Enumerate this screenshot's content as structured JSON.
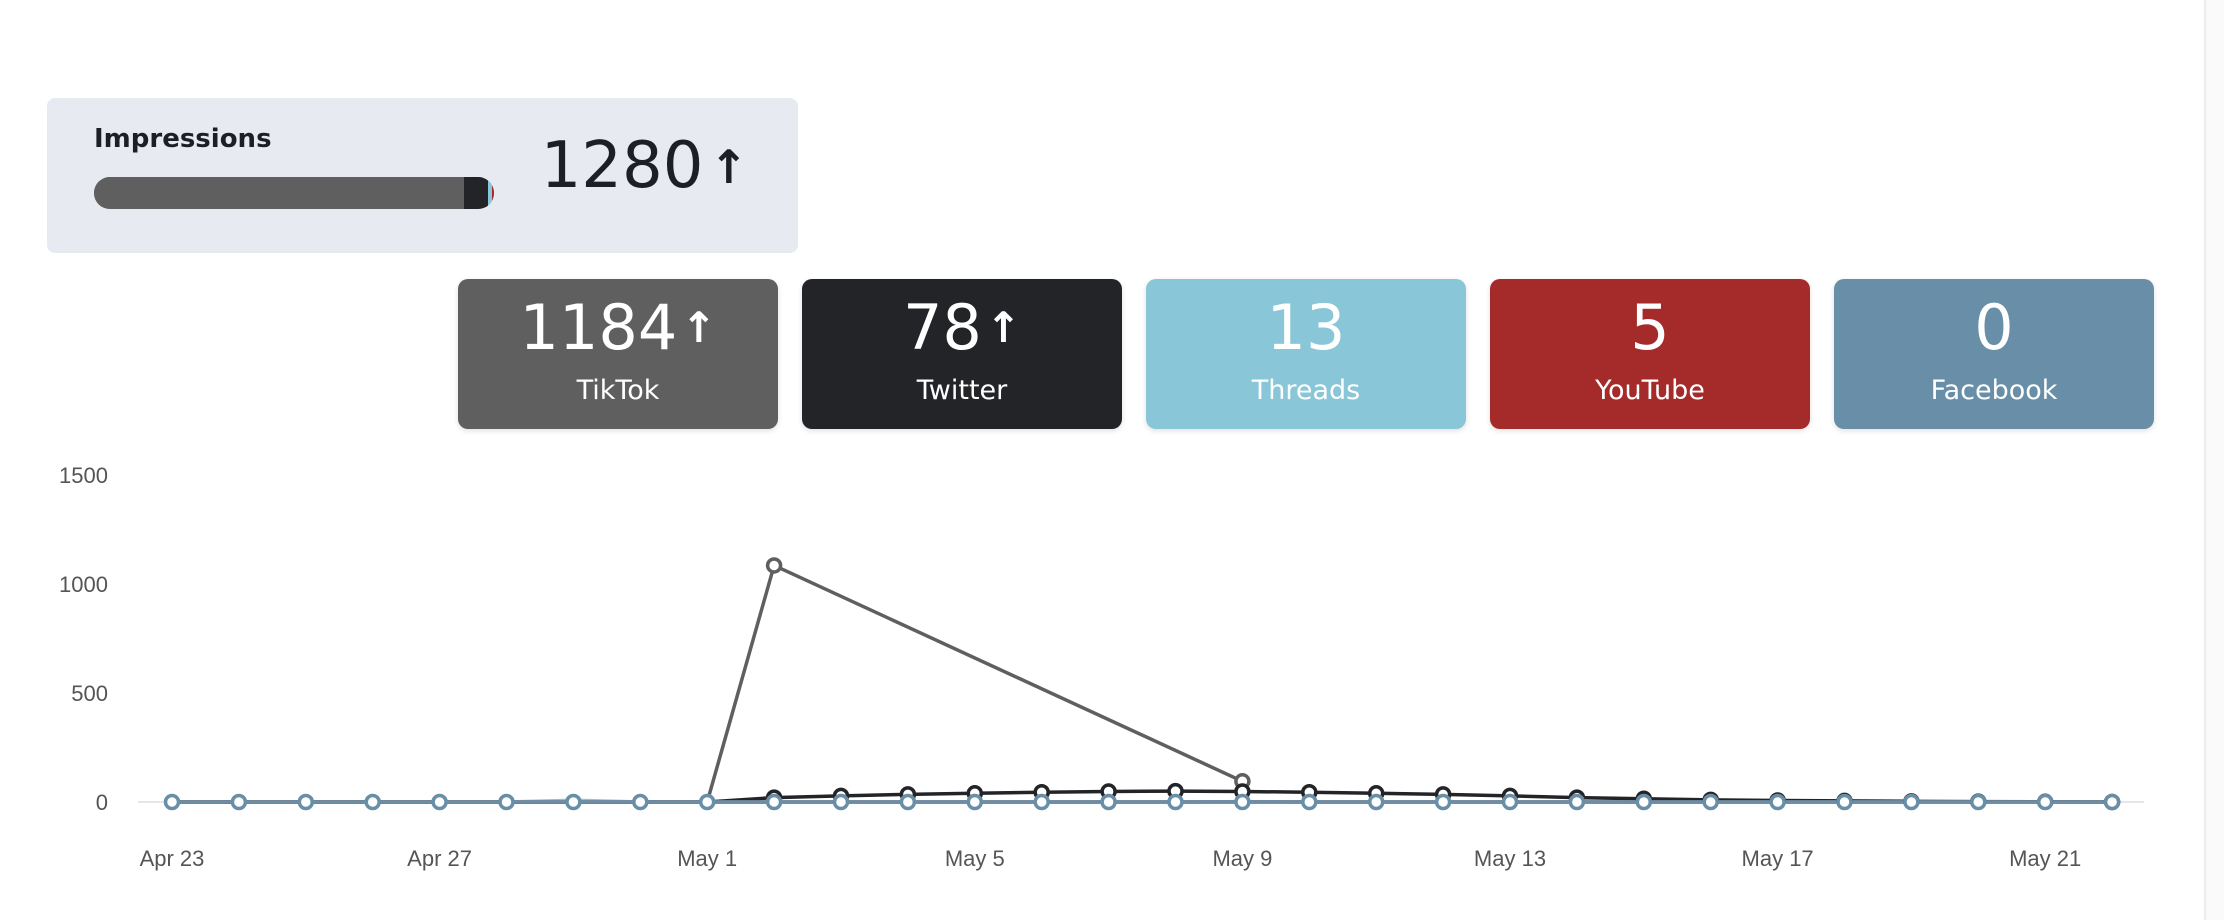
{
  "impressions": {
    "label": "Impressions",
    "value": "1280",
    "trend_icon": "arrow-up-icon",
    "breakdown_bar": [
      {
        "platform": "TikTok",
        "value": 1184,
        "color": "#5f5f5f"
      },
      {
        "platform": "Twitter",
        "value": 78,
        "color": "#222428"
      },
      {
        "platform": "Threads",
        "value": 13,
        "color": "#88c6d8"
      },
      {
        "platform": "YouTube",
        "value": 5,
        "color": "#a52b2b"
      },
      {
        "platform": "Facebook",
        "value": 0,
        "color": "#688fa7"
      }
    ]
  },
  "platforms": [
    {
      "name": "TikTok",
      "value": "1184",
      "trend_up": true,
      "color": "#5f5f5f"
    },
    {
      "name": "Twitter",
      "value": "78",
      "trend_up": true,
      "color": "#222428"
    },
    {
      "name": "Threads",
      "value": "13",
      "trend_up": false,
      "color": "#88c6d8"
    },
    {
      "name": "YouTube",
      "value": "5",
      "trend_up": false,
      "color": "#a52b2b"
    },
    {
      "name": "Facebook",
      "value": "0",
      "trend_up": false,
      "color": "#688fa7"
    }
  ],
  "chart_data": {
    "type": "line",
    "x": [
      "Apr 23",
      "Apr 24",
      "Apr 25",
      "Apr 26",
      "Apr 27",
      "Apr 28",
      "Apr 29",
      "Apr 30",
      "May 1",
      "May 2",
      "May 3",
      "May 4",
      "May 5",
      "May 6",
      "May 7",
      "May 8",
      "May 9",
      "May 10",
      "May 11",
      "May 12",
      "May 13",
      "May 14",
      "May 15",
      "May 16",
      "May 17",
      "May 18",
      "May 19",
      "May 20",
      "May 21",
      "May 22"
    ],
    "x_tick_labels": [
      "Apr 23",
      "Apr 27",
      "May 1",
      "May 5",
      "May 9",
      "May 13",
      "May 17",
      "May 21"
    ],
    "ylim": [
      0,
      1500
    ],
    "y_ticks": [
      0,
      500,
      1000,
      1500
    ],
    "series": [
      {
        "color": "#5f5f5f",
        "point_from_index": 9,
        "values": [
          0,
          0,
          0,
          0,
          0,
          0,
          0,
          0,
          0,
          1085,
          null,
          null,
          null,
          null,
          null,
          null,
          95,
          null,
          null,
          null,
          null,
          null,
          null,
          null,
          null,
          null,
          null,
          null,
          null,
          null
        ]
      },
      {
        "color": "#222428",
        "point_from_index": 9,
        "values": [
          0,
          0,
          0,
          0,
          0,
          0,
          0,
          0,
          0,
          20,
          28,
          35,
          40,
          45,
          48,
          50,
          48,
          45,
          40,
          35,
          28,
          20,
          15,
          10,
          7,
          5,
          3,
          2,
          1,
          0
        ]
      },
      {
        "color": "#88c6d8",
        "point_from_index": 30,
        "values": [
          0,
          0,
          0,
          0,
          0,
          0,
          8,
          0,
          0,
          0,
          0,
          0,
          0,
          0,
          0,
          0,
          2,
          0,
          0,
          0,
          0,
          0,
          0,
          0,
          0,
          0,
          0,
          0,
          0,
          0
        ]
      },
      {
        "color": "#a52b2b",
        "point_from_index": 30,
        "values": [
          0,
          0,
          0,
          0,
          0,
          0,
          0,
          0,
          0,
          0,
          0,
          0,
          0,
          0,
          0,
          0,
          0,
          0,
          0,
          0,
          0,
          0,
          0,
          0,
          0,
          0,
          0,
          0,
          0,
          0
        ]
      },
      {
        "color": "#688fa7",
        "point_from_index": 0,
        "values": [
          0,
          0,
          0,
          0,
          0,
          0,
          0,
          0,
          0,
          0,
          0,
          0,
          0,
          0,
          0,
          0,
          0,
          0,
          0,
          0,
          0,
          0,
          0,
          0,
          0,
          0,
          0,
          0,
          0,
          0
        ]
      }
    ]
  }
}
